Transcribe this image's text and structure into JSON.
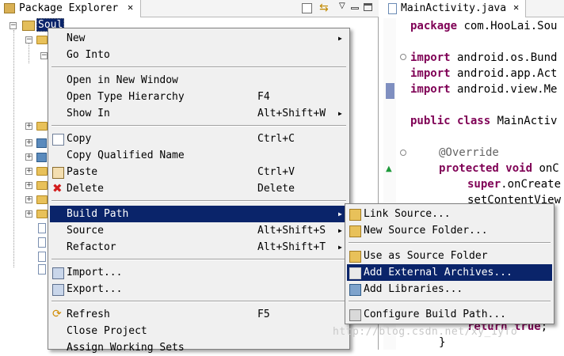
{
  "package_explorer": {
    "title": "Package Explorer",
    "project_name": "Soul"
  },
  "editor": {
    "tab_title": "MainActivity.java",
    "code_lines": [
      {
        "kw": "package",
        "rest": " com.HooLai.Sou"
      },
      {
        "kw": "import",
        "rest": " android.os.Bund"
      },
      {
        "kw": "import",
        "rest": " android.app.Act"
      },
      {
        "kw": "import",
        "rest": " android.view.Me"
      },
      {
        "kw": "public class",
        "rest": " MainActiv"
      },
      {
        "ann": "@Override",
        "rest": ""
      },
      {
        "kw": "protected void",
        "rest": " onC"
      },
      {
        "kw": "super",
        "rest": ".onCreate"
      },
      {
        "kw": "",
        "rest": "setContentView"
      },
      {
        "kw": "return true",
        "rest": ";"
      },
      {
        "kw": "",
        "rest": "}"
      }
    ]
  },
  "context_menu": {
    "items": [
      {
        "label": "New",
        "shortcut": "",
        "submenu": true
      },
      {
        "label": "Go Into",
        "shortcut": ""
      },
      {
        "label": "Open in New Window",
        "shortcut": ""
      },
      {
        "label": "Open Type Hierarchy",
        "shortcut": "F4"
      },
      {
        "label": "Show In",
        "shortcut": "Alt+Shift+W",
        "submenu": true
      },
      {
        "label": "Copy",
        "shortcut": "Ctrl+C"
      },
      {
        "label": "Copy Qualified Name",
        "shortcut": ""
      },
      {
        "label": "Paste",
        "shortcut": "Ctrl+V"
      },
      {
        "label": "Delete",
        "shortcut": "Delete"
      },
      {
        "label": "Build Path",
        "shortcut": "",
        "submenu": true,
        "selected": true
      },
      {
        "label": "Source",
        "shortcut": "Alt+Shift+S",
        "submenu": true
      },
      {
        "label": "Refactor",
        "shortcut": "Alt+Shift+T",
        "submenu": true
      },
      {
        "label": "Import...",
        "shortcut": ""
      },
      {
        "label": "Export...",
        "shortcut": ""
      },
      {
        "label": "Refresh",
        "shortcut": "F5"
      },
      {
        "label": "Close Project",
        "shortcut": ""
      },
      {
        "label": "Assign Working Sets",
        "shortcut": ""
      }
    ]
  },
  "build_path_submenu": {
    "items": [
      {
        "label": "Link Source..."
      },
      {
        "label": "New Source Folder..."
      },
      {
        "label": "Use as Source Folder"
      },
      {
        "label": "Add External Archives...",
        "selected": true
      },
      {
        "label": "Add Libraries..."
      },
      {
        "label": "Configure Build Path..."
      }
    ]
  },
  "watermark": "http://blog.csdn.net/xy_1yfo",
  "colors": {
    "selection": "#0a246a",
    "menu_bg": "#f0f0f0",
    "keyword": "#7f0055"
  }
}
